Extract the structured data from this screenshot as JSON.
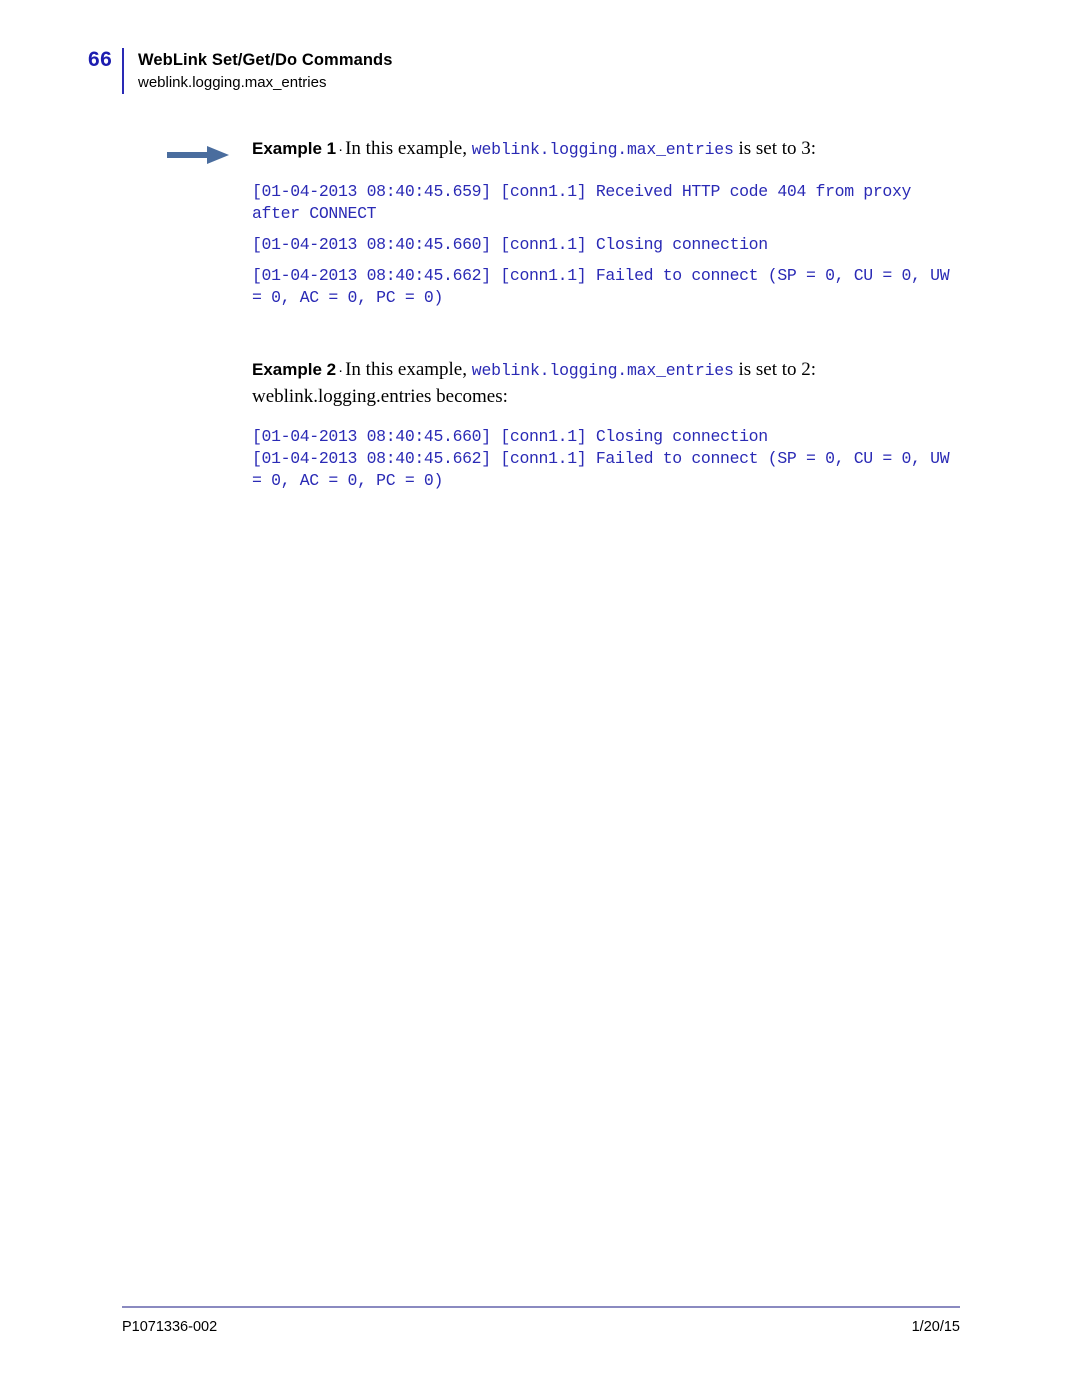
{
  "header": {
    "page_number": "66",
    "title": "WebLink Set/Get/Do Commands",
    "subtitle": "weblink.logging.max_entries"
  },
  "colors": {
    "page_number": "#1d1db0",
    "header_rule": "#2a2ab5",
    "code_text": "#2a2ab5",
    "arrow": "#4a6d9e",
    "footer_rule": "#8a8ac0"
  },
  "icons": {
    "arrow": "right-arrow-icon"
  },
  "examples": [
    {
      "label": "Example 1",
      "separator": "·",
      "lead_prefix": "In this example,",
      "lead_code": "weblink.logging.max_entries",
      "lead_suffix": "is set to 3:",
      "lead_line2": "",
      "code_paragraphs": [
        "[01-04-2013 08:40:45.659] [conn1.1] Received HTTP code 404 from proxy after CONNECT",
        "[01-04-2013 08:40:45.660] [conn1.1] Closing connection",
        "[01-04-2013 08:40:45.662] [conn1.1] Failed to connect (SP = 0, CU = 0, UW = 0, AC = 0, PC = 0)"
      ]
    },
    {
      "label": "Example 2",
      "separator": "·",
      "lead_prefix": "In this example,",
      "lead_code": "weblink.logging.max_entries",
      "lead_suffix": "is set to 2:",
      "lead_line2": "weblink.logging.entries becomes:",
      "code_paragraphs": [
        "[01-04-2013 08:40:45.660] [conn1.1] Closing connection",
        "[01-04-2013 08:40:45.662] [conn1.1] Failed to connect (SP = 0, CU = 0, UW = 0, AC = 0, PC = 0)"
      ]
    }
  ],
  "footer": {
    "document_id": "P1071336-002",
    "date": "1/20/15"
  }
}
